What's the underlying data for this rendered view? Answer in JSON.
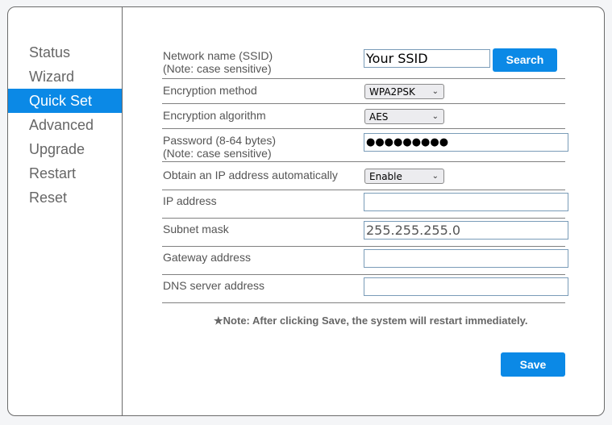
{
  "sidebar": {
    "items": [
      {
        "label": "Status",
        "active": false
      },
      {
        "label": "Wizard",
        "active": false
      },
      {
        "label": "Quick Set",
        "active": true
      },
      {
        "label": "Advanced",
        "active": false
      },
      {
        "label": "Upgrade",
        "active": false
      },
      {
        "label": "Restart",
        "active": false
      },
      {
        "label": "Reset",
        "active": false
      }
    ]
  },
  "form": {
    "ssid": {
      "label": "Network name (SSID)",
      "note": "(Note: case sensitive)",
      "value": "Your SSID",
      "search_label": "Search"
    },
    "encryption_method": {
      "label": "Encryption method",
      "value": "WPA2PSK"
    },
    "encryption_algorithm": {
      "label": "Encryption algorithm",
      "value": "AES"
    },
    "password": {
      "label": "Password (8-64 bytes)",
      "note": "(Note: case sensitive)",
      "value": "●●●●●●●●●"
    },
    "dhcp": {
      "label": "Obtain an IP address automatically",
      "value": "Enable"
    },
    "ip_address": {
      "label": "IP address",
      "value": ""
    },
    "subnet_mask": {
      "label": "Subnet mask",
      "value": "255.255.255.0"
    },
    "gateway": {
      "label": "Gateway address",
      "value": ""
    },
    "dns": {
      "label": "DNS server address",
      "value": ""
    }
  },
  "note": "★Note: After clicking Save, the system will restart immediately.",
  "save_label": "Save",
  "icons": {
    "chevron": "⌄"
  },
  "colors": {
    "accent": "#0b89e6"
  }
}
